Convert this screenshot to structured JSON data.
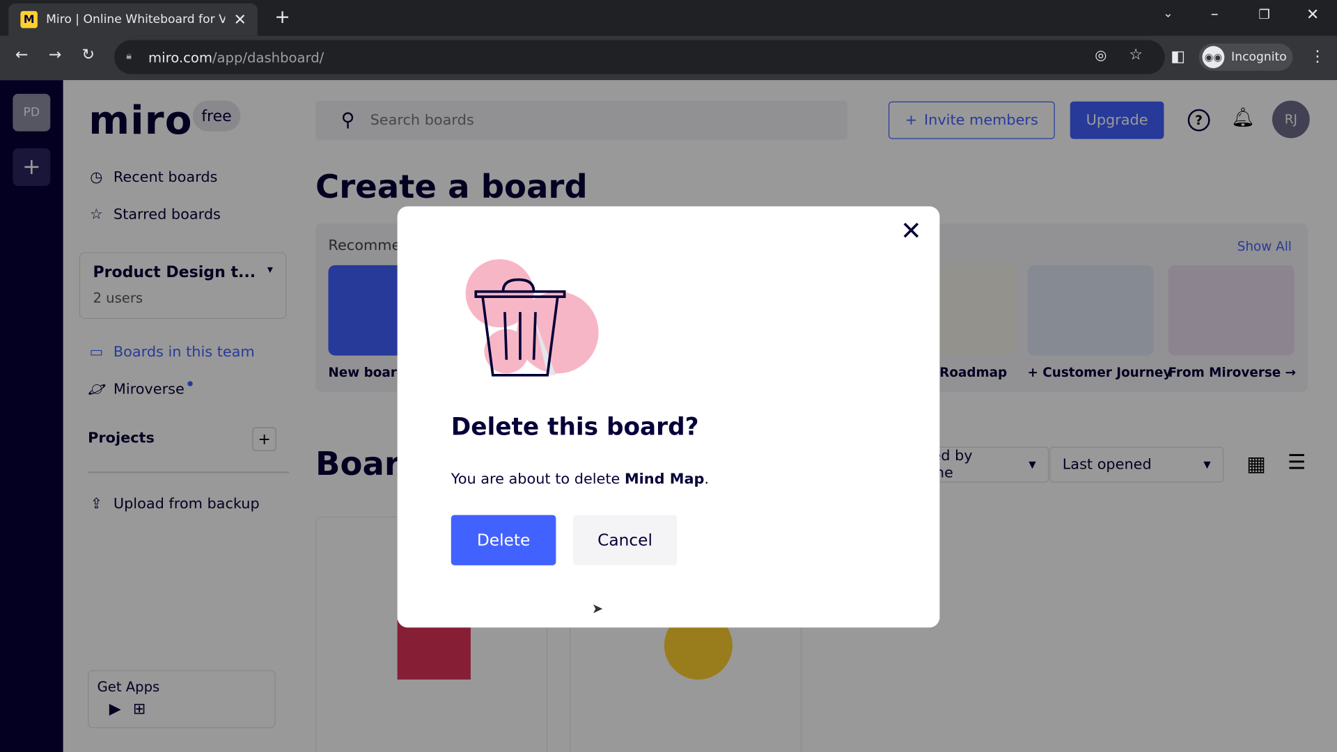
{
  "browser": {
    "tab_title": "Miro | Online Whiteboard for Visual Collaboration",
    "url_host": "miro.com",
    "url_path": "/app/dashboard/",
    "incognito_label": "Incognito"
  },
  "rail": {
    "team_initials": "PD"
  },
  "sidebar": {
    "logo": "miro",
    "plan_badge": "free",
    "recent": "Recent boards",
    "starred": "Starred boards",
    "team": {
      "name": "Product Design t...",
      "users": "2 users"
    },
    "boards_in_team": "Boards in this team",
    "miroverse": "Miroverse",
    "projects": "Projects",
    "upload": "Upload from backup",
    "get_apps": "Get Apps"
  },
  "header": {
    "search_placeholder": "Search boards",
    "invite": "Invite members",
    "upgrade": "Upgrade",
    "avatar": "RJ"
  },
  "main": {
    "create_title": "Create a board",
    "recommended": "Recommended templates",
    "show_all": "Show All",
    "templates": [
      {
        "label": "New board"
      },
      {
        "label": "Product Roadmap"
      },
      {
        "label": "+ Customer Journey"
      },
      {
        "label": "From Miroverse →"
      }
    ],
    "boards_title": "Boards in this team",
    "owner_filter": "Owned by anyone",
    "sort": "Last opened"
  },
  "modal": {
    "title": "Delete this board?",
    "text_prefix": "You are about to delete ",
    "board_name": "Mind Map",
    "text_suffix": ".",
    "delete": "Delete",
    "cancel": "Cancel"
  },
  "colors": {
    "accent": "#4262ff",
    "rail": "#050038",
    "illustration_pink": "#f7b6c6"
  }
}
